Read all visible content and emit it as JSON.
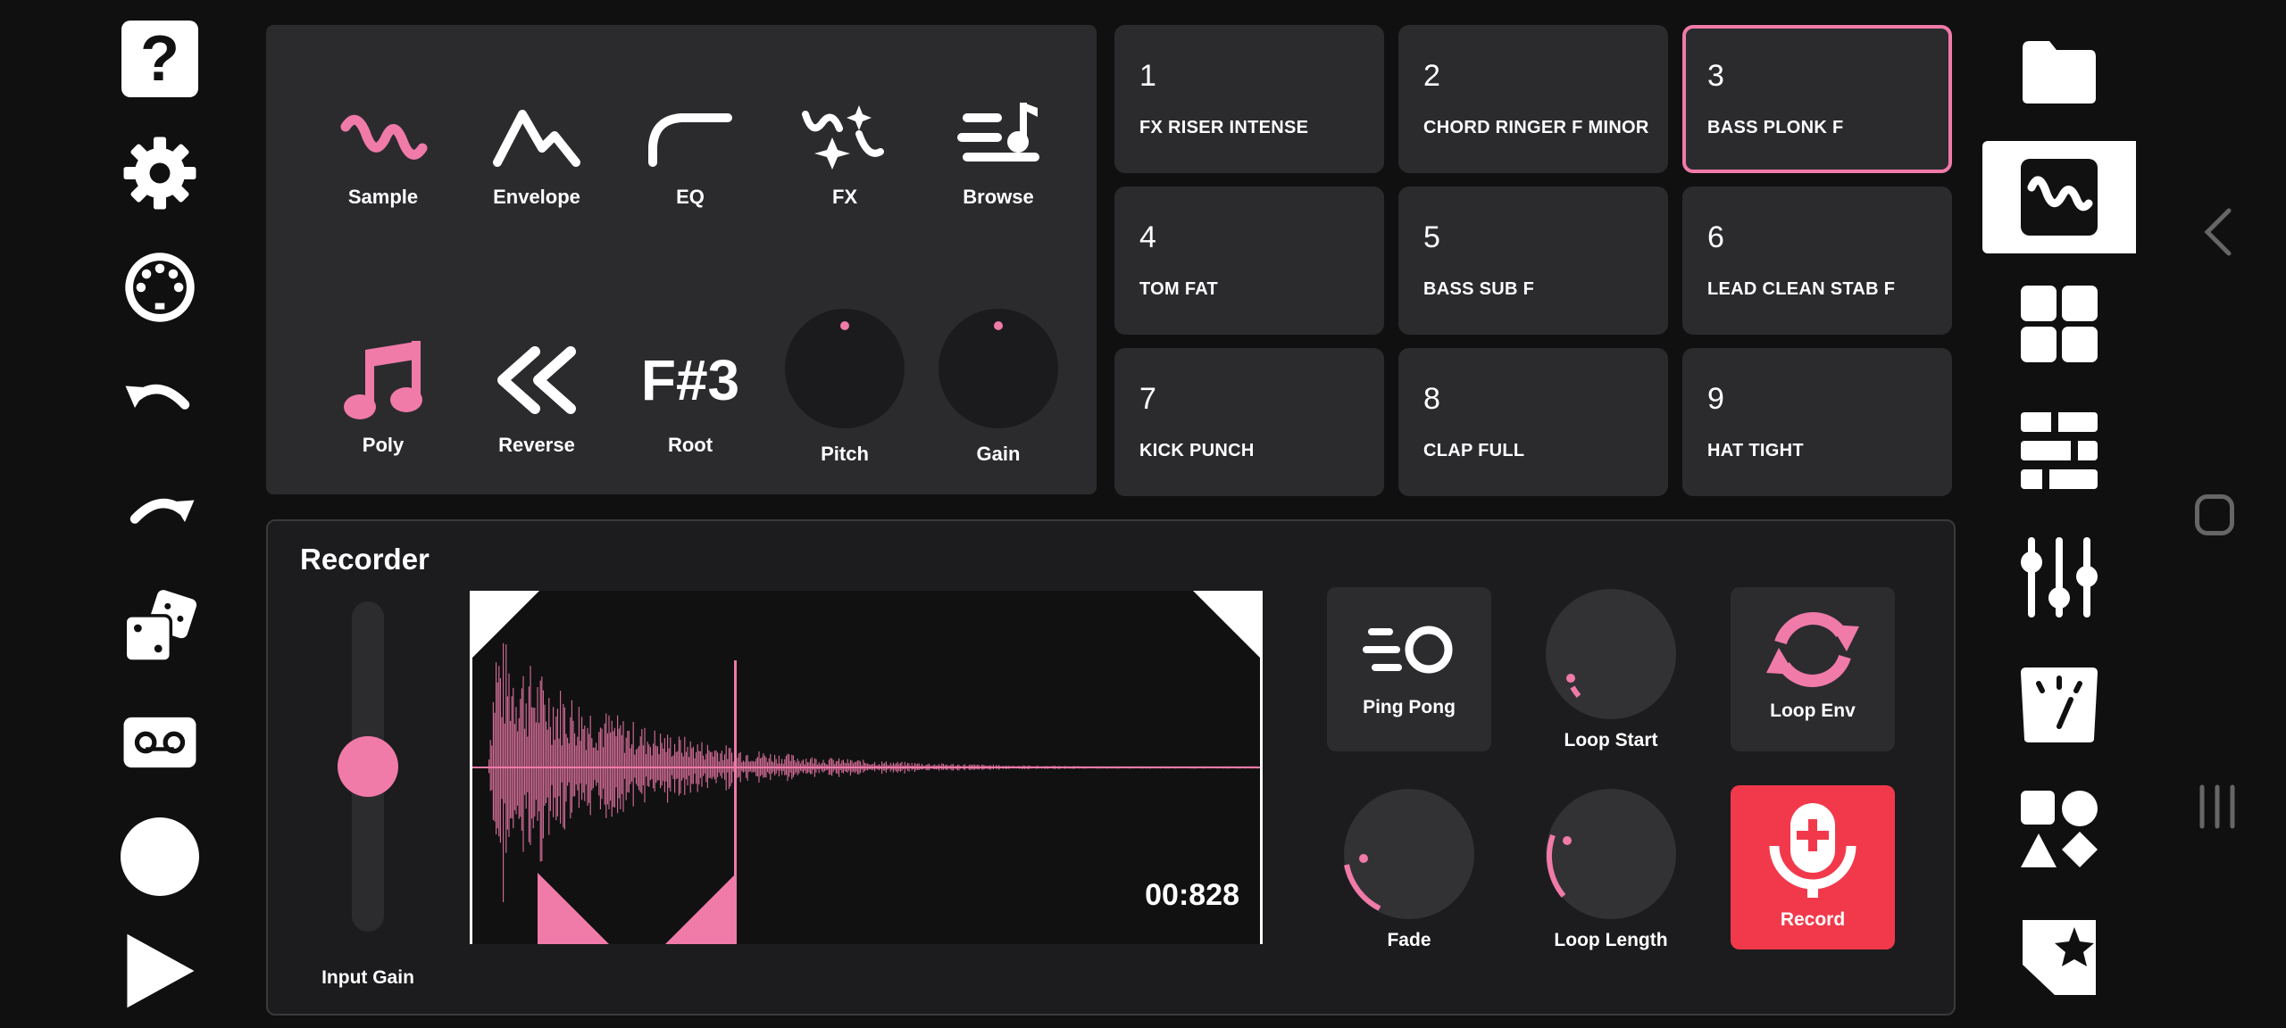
{
  "left_toolbar": {
    "icons": [
      "help-icon",
      "settings-icon",
      "midi-icon",
      "undo-icon",
      "redo-icon",
      "dice-icon",
      "tape-icon",
      "record-circle-icon",
      "play-icon"
    ],
    "help_glyph": "?"
  },
  "sample_panel": {
    "tools": [
      {
        "label": "Sample",
        "icon": "sample-wave-icon"
      },
      {
        "label": "Envelope",
        "icon": "envelope-icon"
      },
      {
        "label": "EQ",
        "icon": "eq-icon"
      },
      {
        "label": "FX",
        "icon": "fx-sparkle-icon"
      },
      {
        "label": "Browse",
        "icon": "browse-icon"
      },
      {
        "label": "Poly",
        "icon": "music-note-icon"
      },
      {
        "label": "Reverse",
        "icon": "reverse-icon"
      },
      {
        "label": "Root",
        "value": "F#3"
      },
      {
        "label": "Pitch",
        "icon": "knob"
      },
      {
        "label": "Gain",
        "icon": "knob"
      }
    ]
  },
  "pads": [
    {
      "num": "1",
      "name": "FX RISER INTENSE",
      "selected": false
    },
    {
      "num": "2",
      "name": "CHORD RINGER F MINOR",
      "selected": false
    },
    {
      "num": "3",
      "name": "BASS PLONK F",
      "selected": true
    },
    {
      "num": "4",
      "name": "TOM FAT",
      "selected": false
    },
    {
      "num": "5",
      "name": "BASS SUB F",
      "selected": false
    },
    {
      "num": "6",
      "name": "LEAD CLEAN STAB F",
      "selected": false
    },
    {
      "num": "7",
      "name": "KICK PUNCH",
      "selected": false
    },
    {
      "num": "8",
      "name": "CLAP FULL",
      "selected": false
    },
    {
      "num": "9",
      "name": "HAT TIGHT",
      "selected": false
    }
  ],
  "recorder": {
    "title": "Recorder",
    "input_gain_label": "Input Gain",
    "input_gain_level": 0.5,
    "time": "00:828",
    "ping_pong_label": "Ping Pong",
    "loop_start_label": "Loop Start",
    "loop_env_label": "Loop Env",
    "fade_label": "Fade",
    "loop_length_label": "Loop Length",
    "record_label": "Record"
  },
  "right_toolbar": {
    "icons": [
      "folder-icon",
      "sample-wave-icon",
      "pads-grid-icon",
      "sequencer-icon",
      "mixer-icon",
      "tempo-icon",
      "shapes-icon",
      "star-photo-icon"
    ],
    "active_index": 1
  },
  "colors": {
    "accent": "#f07aa8",
    "record": "#f2394b",
    "panel": "#2b2b2e",
    "background": "#101011"
  }
}
